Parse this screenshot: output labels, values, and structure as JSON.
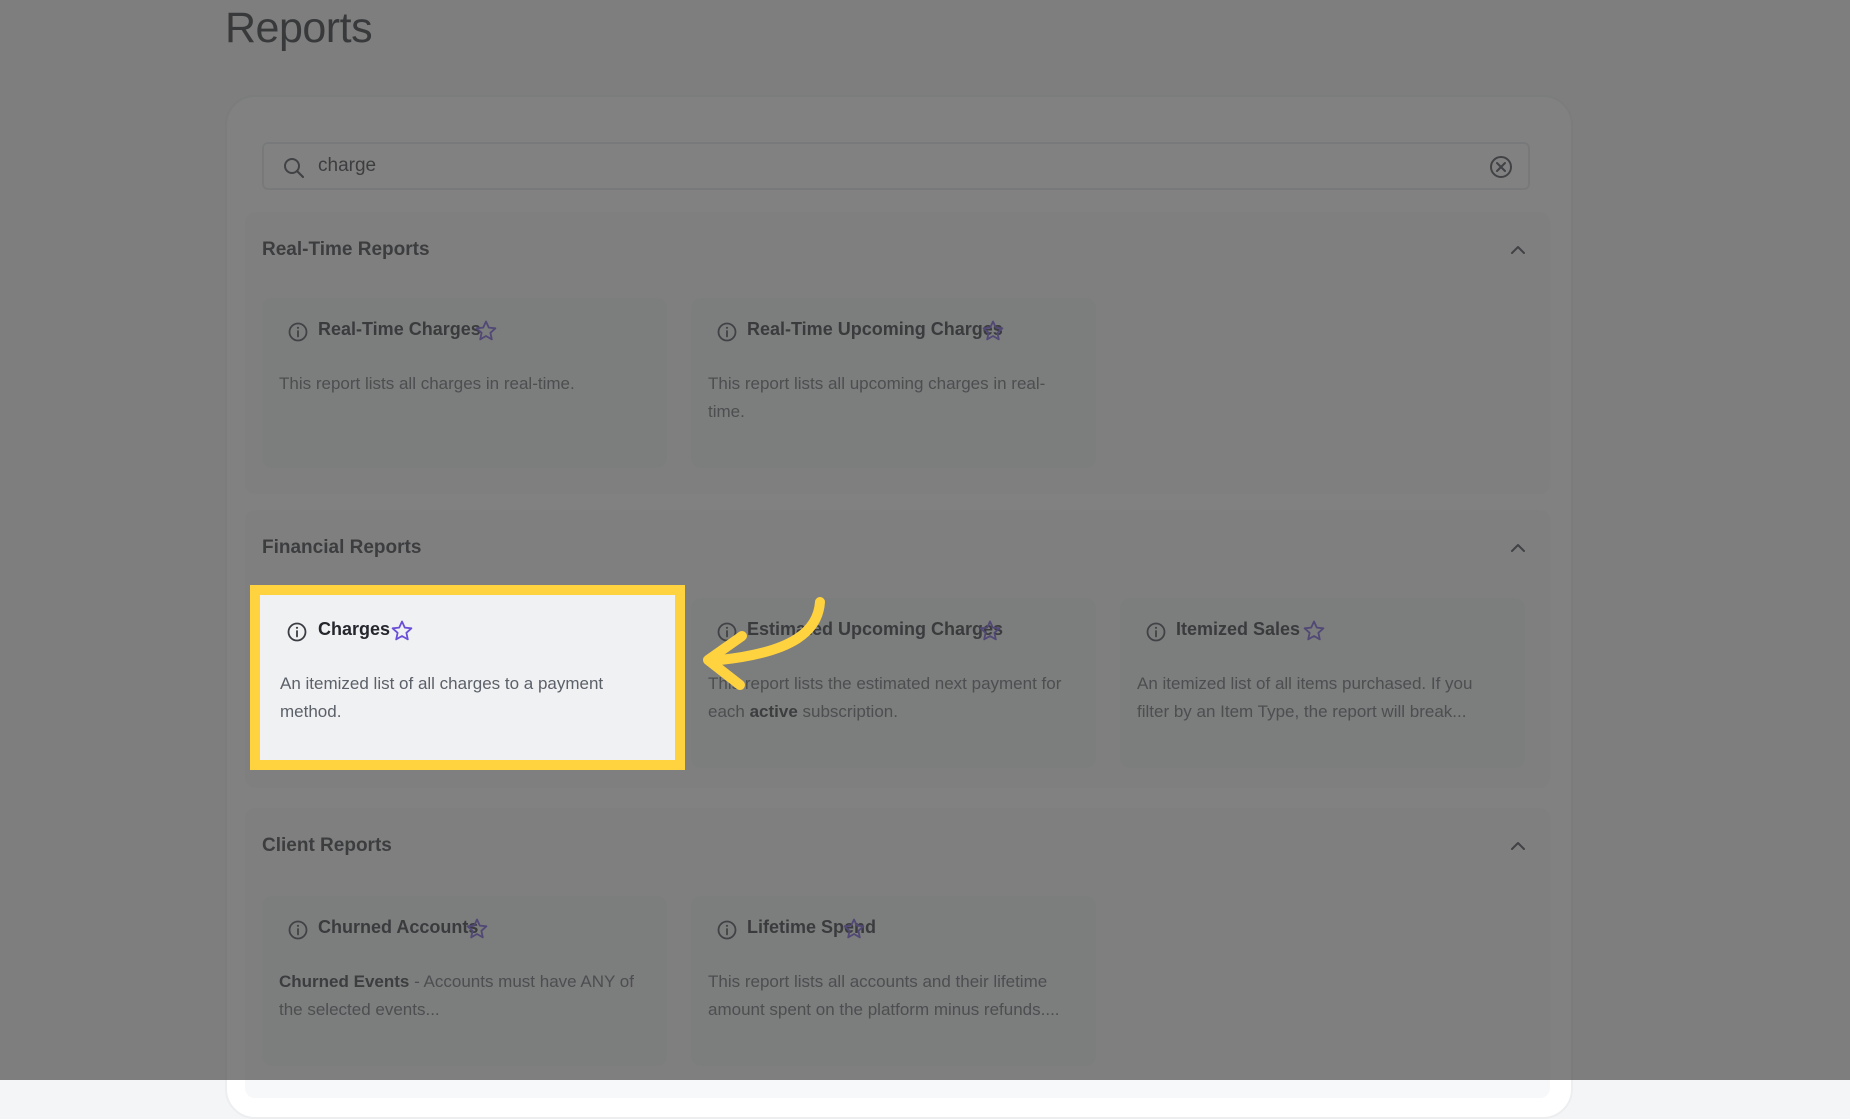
{
  "page": {
    "title": "Reports"
  },
  "search": {
    "value": "charge",
    "placeholder": ""
  },
  "sections": [
    {
      "title": "Real-Time Reports",
      "cards": [
        {
          "title": "Real-Time Charges",
          "description": "This report lists all charges in real-time."
        },
        {
          "title": "Real-Time Upcoming Charges",
          "description": "This report lists all upcoming charges in real-time."
        }
      ]
    },
    {
      "title": "Financial Reports",
      "cards": [
        {
          "title": "Charges",
          "description": "An itemized list of all charges to a payment method."
        },
        {
          "title": "Estimated Upcoming Charges",
          "description_pre": "This report lists the estimated next payment for each ",
          "description_bold": "active",
          "description_post": " subscription."
        },
        {
          "title": "Itemized Sales",
          "description": "An itemized list of all items purchased. If you filter by an Item Type, the report will break..."
        }
      ]
    },
    {
      "title": "Client Reports",
      "cards": [
        {
          "title": "Churned Accounts",
          "description_bold": "Churned Events",
          "description_post": " - Accounts must have ANY of the selected events..."
        },
        {
          "title": "Lifetime Spend",
          "description": "This report lists all accounts and their lifetime amount spent on the platform minus refunds...."
        }
      ]
    }
  ],
  "icons": {
    "info": "info-circle-icon",
    "favorite": "star-outline-icon",
    "collapse": "chevron-up-icon",
    "search": "search-icon",
    "clear": "clear-circle-icon"
  },
  "colors": {
    "accent_star": "#6a4fd8",
    "highlight": "#ffd23f",
    "overlay": "#464646"
  }
}
